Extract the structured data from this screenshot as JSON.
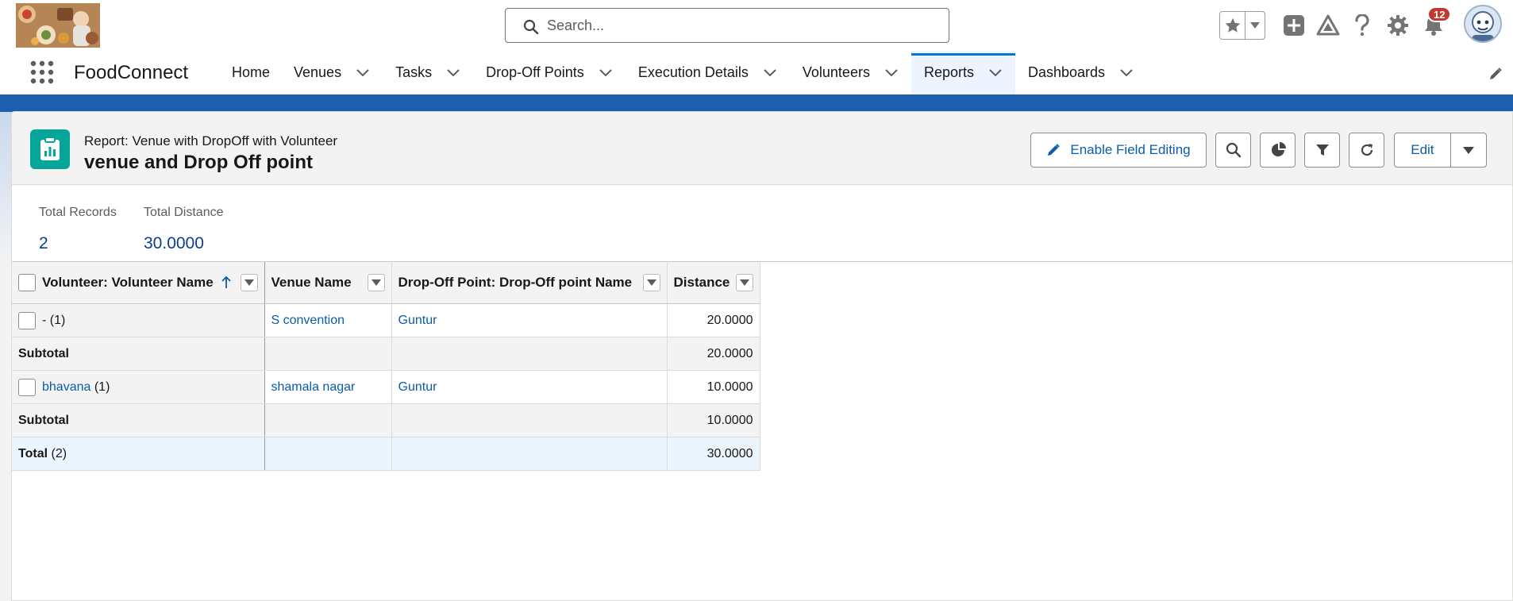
{
  "header": {
    "search_placeholder": "Search...",
    "notification_count": "12",
    "icons": [
      "favorites-star-icon",
      "favorites-list-icon",
      "add-icon",
      "trailhead-icon",
      "help-icon",
      "setup-gear-icon",
      "notifications-bell-icon",
      "user-avatar"
    ]
  },
  "nav": {
    "app_name": "FoodConnect",
    "items": [
      {
        "label": "Home",
        "has_menu": false
      },
      {
        "label": "Venues",
        "has_menu": true
      },
      {
        "label": "Tasks",
        "has_menu": true
      },
      {
        "label": "Drop-Off Points",
        "has_menu": true
      },
      {
        "label": "Execution Details",
        "has_menu": true
      },
      {
        "label": "Volunteers",
        "has_menu": true
      },
      {
        "label": "Reports",
        "has_menu": true,
        "active": true
      },
      {
        "label": "Dashboards",
        "has_menu": true
      }
    ]
  },
  "report": {
    "eyebrow": "Report: Venue with DropOff with Volunteer",
    "title": "venue and Drop Off point",
    "buttons": {
      "enable_field_editing": "Enable Field Editing",
      "edit": "Edit"
    },
    "summary": [
      {
        "label": "Total Records",
        "value": "2"
      },
      {
        "label": "Total Distance",
        "value": "30.0000"
      }
    ],
    "columns": [
      "Volunteer: Volunteer Name",
      "Venue Name",
      "Drop-Off Point: Drop-Off point Name",
      "Distance"
    ],
    "groups": [
      {
        "name": "-",
        "count": "(1)",
        "venue": "S convention",
        "dropoff": "Guntur",
        "distance": "20.0000",
        "subtotal_label": "Subtotal",
        "subtotal": "20.0000"
      },
      {
        "name": "bhavana",
        "count": "(1)",
        "venue": "shamala nagar",
        "dropoff": "Guntur",
        "distance": "10.0000",
        "subtotal_label": "Subtotal",
        "subtotal": "10.0000"
      }
    ],
    "total": {
      "label": "Total",
      "count": "(2)",
      "distance": "30.0000"
    }
  },
  "colors": {
    "brand_blue": "#1b5fae",
    "link": "#0b5cab",
    "report_icon": "#06a59a",
    "badge": "#c23934",
    "active_tab_bar": "#0176d3"
  }
}
